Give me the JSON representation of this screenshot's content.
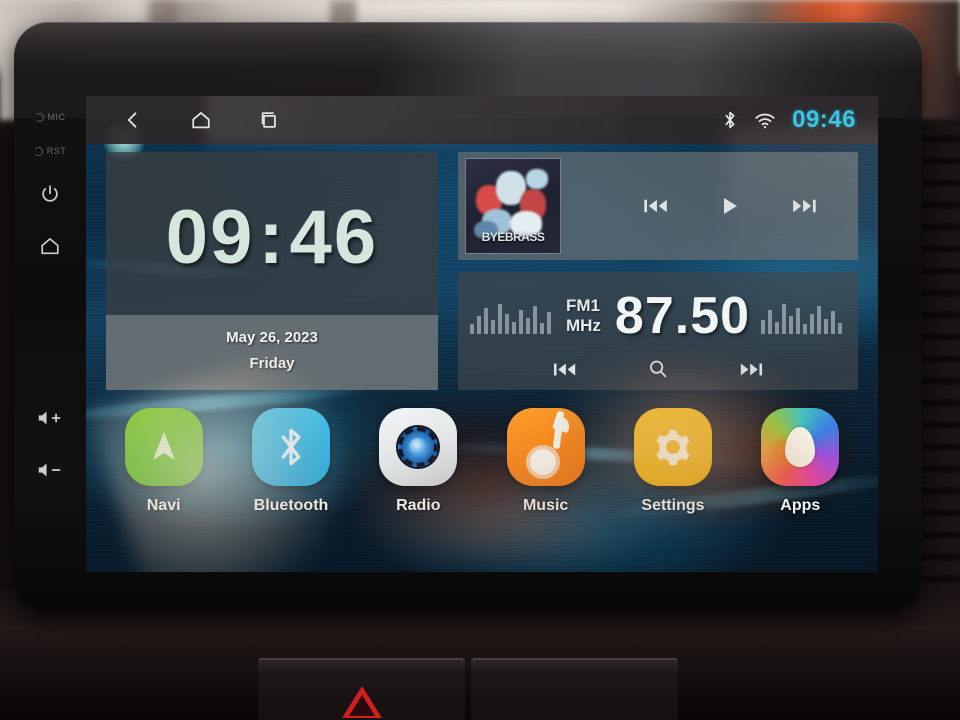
{
  "device": {
    "bezel": {
      "mic_label": "MIC",
      "rst_label": "RST",
      "keys": [
        {
          "name": "power",
          "label": ""
        },
        {
          "name": "home",
          "label": ""
        },
        {
          "name": "volume-up",
          "label": ""
        },
        {
          "name": "volume-down",
          "label": ""
        }
      ]
    }
  },
  "statusbar": {
    "back_icon": "back-arrow-icon",
    "home_icon": "home-icon",
    "recents_icon": "recents-icon",
    "bluetooth_icon": "bluetooth-icon",
    "wifi_icon": "wifi-icon",
    "clock": "09:46",
    "clock_color": "#36c6e6"
  },
  "clock_widget": {
    "hours": "09",
    "separator": ":",
    "minutes": "46",
    "date": "May 26, 2023",
    "weekday": "Friday"
  },
  "media_widget": {
    "album_art_text": "BYEBRASS",
    "prev_icon": "skip-previous-icon",
    "play_icon": "play-icon",
    "next_icon": "skip-next-icon"
  },
  "radio_widget": {
    "band": "FM1",
    "unit": "MHz",
    "frequency": "87.50",
    "prev_icon": "tune-previous-icon",
    "search_icon": "search-icon",
    "next_icon": "tune-next-icon"
  },
  "dock": {
    "apps": [
      {
        "label": "Navi",
        "icon": "navigation-arrow-icon",
        "color": "#59c21a"
      },
      {
        "label": "Bluetooth",
        "icon": "bluetooth-icon",
        "color": "#2fb6e8"
      },
      {
        "label": "Radio",
        "icon": "radio-dial-icon",
        "color": "#dfe3e4"
      },
      {
        "label": "Music",
        "icon": "music-note-icon",
        "color": "#f5861c"
      },
      {
        "label": "Settings",
        "icon": "gear-icon",
        "color": "#f5b60b"
      },
      {
        "label": "Apps",
        "icon": "apps-flower-icon",
        "color": "#9c4fd8"
      }
    ]
  },
  "console": {
    "hazard_icon": "hazard-triangle-icon"
  }
}
